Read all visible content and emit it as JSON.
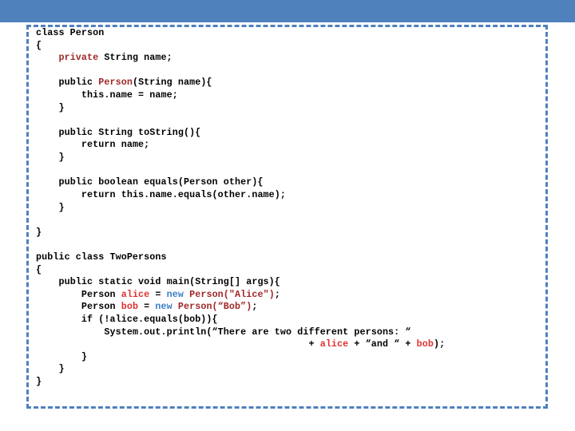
{
  "header": {
    "bar_color": "#4f81bd"
  },
  "code_frame": {
    "border_color": "#4f81bd",
    "border_style": "dashed"
  },
  "colors": {
    "keyword_dark_red": "#a02828",
    "variable_red": "#e03030",
    "new_blue": "#3a7fc4",
    "plain_black": "#000000",
    "accent_blue": "#4f81bd"
  },
  "code": {
    "language": "java",
    "lines": [
      {
        "id": "l1",
        "indent": 0,
        "runs": [
          {
            "t": "class Person",
            "c": "plain"
          }
        ]
      },
      {
        "id": "l2",
        "indent": 0,
        "runs": [
          {
            "t": "{",
            "c": "plain"
          }
        ]
      },
      {
        "id": "l3",
        "indent": 4,
        "runs": [
          {
            "t": "private",
            "c": "darkred"
          },
          {
            "t": " String name;",
            "c": "plain"
          }
        ]
      },
      {
        "id": "l4",
        "indent": 0,
        "runs": [
          {
            "t": "",
            "c": "plain"
          }
        ]
      },
      {
        "id": "l5",
        "indent": 4,
        "runs": [
          {
            "t": "public ",
            "c": "plain"
          },
          {
            "t": "Person",
            "c": "darkred"
          },
          {
            "t": "(String name){",
            "c": "plain"
          }
        ]
      },
      {
        "id": "l6",
        "indent": 8,
        "runs": [
          {
            "t": "this.name = name;",
            "c": "plain"
          }
        ]
      },
      {
        "id": "l7",
        "indent": 4,
        "runs": [
          {
            "t": "}",
            "c": "plain"
          }
        ]
      },
      {
        "id": "l8",
        "indent": 0,
        "runs": [
          {
            "t": "",
            "c": "plain"
          }
        ]
      },
      {
        "id": "l9",
        "indent": 4,
        "runs": [
          {
            "t": "public String toString(){",
            "c": "plain"
          }
        ]
      },
      {
        "id": "l10",
        "indent": 8,
        "runs": [
          {
            "t": "return name;",
            "c": "plain"
          }
        ]
      },
      {
        "id": "l11",
        "indent": 4,
        "runs": [
          {
            "t": "}",
            "c": "plain"
          }
        ]
      },
      {
        "id": "l12",
        "indent": 0,
        "runs": [
          {
            "t": "",
            "c": "plain"
          }
        ]
      },
      {
        "id": "l13",
        "indent": 4,
        "runs": [
          {
            "t": "public boolean equals(Person other){",
            "c": "plain"
          }
        ]
      },
      {
        "id": "l14",
        "indent": 8,
        "runs": [
          {
            "t": "return this.name.equals(other.name);",
            "c": "plain"
          }
        ]
      },
      {
        "id": "l15",
        "indent": 4,
        "runs": [
          {
            "t": "}",
            "c": "plain"
          }
        ]
      },
      {
        "id": "l16",
        "indent": 0,
        "runs": [
          {
            "t": "",
            "c": "plain"
          }
        ]
      },
      {
        "id": "l17",
        "indent": 0,
        "runs": [
          {
            "t": "}",
            "c": "plain"
          }
        ]
      },
      {
        "id": "l18",
        "indent": 0,
        "runs": [
          {
            "t": "",
            "c": "plain"
          }
        ]
      },
      {
        "id": "l19",
        "indent": 0,
        "runs": [
          {
            "t": "public class TwoPersons",
            "c": "plain"
          }
        ]
      },
      {
        "id": "l20",
        "indent": 0,
        "runs": [
          {
            "t": "{",
            "c": "plain"
          }
        ]
      },
      {
        "id": "l21",
        "indent": 4,
        "runs": [
          {
            "t": "public static void main(String[] args){",
            "c": "plain"
          }
        ]
      },
      {
        "id": "l22",
        "indent": 8,
        "runs": [
          {
            "t": "Person ",
            "c": "plain"
          },
          {
            "t": "alice",
            "c": "var"
          },
          {
            "t": " = ",
            "c": "plain"
          },
          {
            "t": "new",
            "c": "new"
          },
          {
            "t": " ",
            "c": "plain"
          },
          {
            "t": "Person(\"Alice\")",
            "c": "darkred"
          },
          {
            "t": ";",
            "c": "plain"
          }
        ]
      },
      {
        "id": "l23",
        "indent": 8,
        "runs": [
          {
            "t": "Person ",
            "c": "plain"
          },
          {
            "t": "bob",
            "c": "var"
          },
          {
            "t": " = ",
            "c": "plain"
          },
          {
            "t": "new",
            "c": "new"
          },
          {
            "t": " ",
            "c": "plain"
          },
          {
            "t": "Person(“Bob”)",
            "c": "darkred"
          },
          {
            "t": ";",
            "c": "plain"
          }
        ]
      },
      {
        "id": "l24",
        "indent": 8,
        "runs": [
          {
            "t": "if (!alice.equals(bob)){",
            "c": "plain"
          }
        ]
      },
      {
        "id": "l25",
        "indent": 12,
        "runs": [
          {
            "t": "System.out.println(“There are two different persons: “",
            "c": "plain"
          }
        ]
      },
      {
        "id": "l26",
        "indent": 48,
        "runs": [
          {
            "t": "+ ",
            "c": "plain"
          },
          {
            "t": "alice",
            "c": "var"
          },
          {
            "t": " + “and “ + ",
            "c": "plain"
          },
          {
            "t": "bob",
            "c": "var"
          },
          {
            "t": ");",
            "c": "plain"
          }
        ]
      },
      {
        "id": "l27",
        "indent": 8,
        "runs": [
          {
            "t": "}",
            "c": "plain"
          }
        ]
      },
      {
        "id": "l28",
        "indent": 4,
        "runs": [
          {
            "t": "}",
            "c": "plain"
          }
        ]
      },
      {
        "id": "l29",
        "indent": 0,
        "runs": [
          {
            "t": "}",
            "c": "plain"
          }
        ]
      }
    ]
  }
}
